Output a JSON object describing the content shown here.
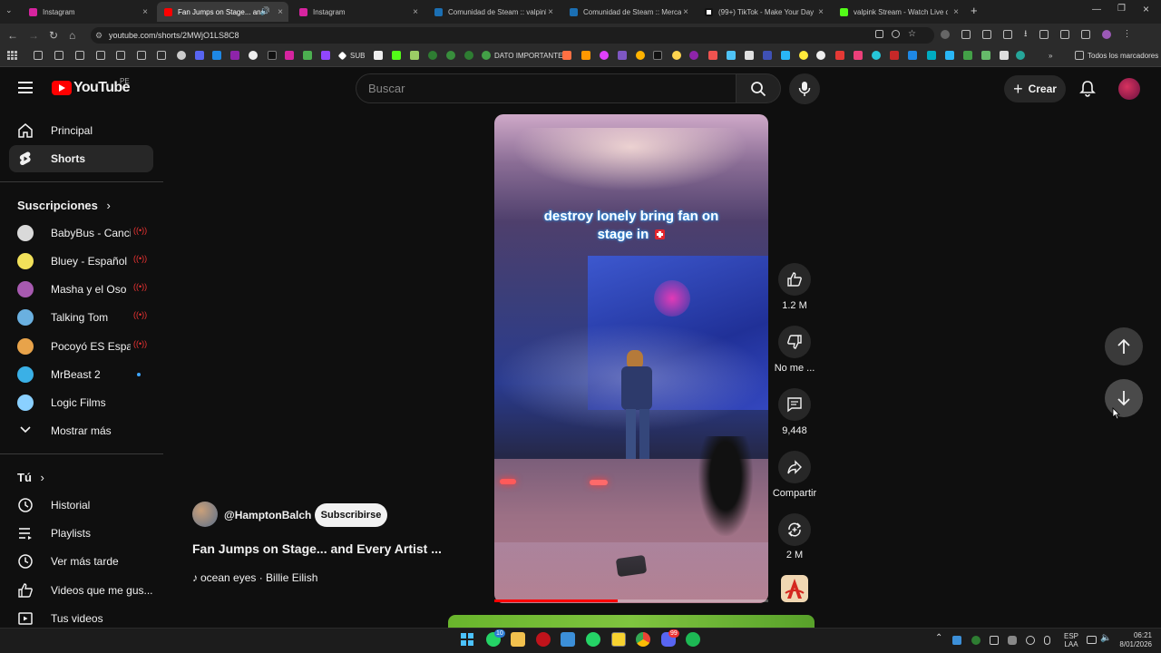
{
  "browser": {
    "tabs": [
      {
        "title": "Instagram",
        "color": "#d6249f"
      },
      {
        "title": "Fan Jumps on Stage... and Every Artist",
        "color": "#ff0000",
        "active": true
      },
      {
        "title": "Instagram",
        "color": "#d6249f"
      },
      {
        "title": "Comunidad de Steam :: valpink",
        "color": "#1b6fb3"
      },
      {
        "title": "Comunidad de Steam :: Mercado",
        "color": "#1b6fb3"
      },
      {
        "title": "(99+) TikTok - Make Your Day",
        "color": "#111111"
      },
      {
        "title": "valpink Stream - Watch Live on",
        "color": "#53fc18"
      }
    ],
    "url": "youtube.com/shorts/2MWjO1LS8C8",
    "bookmarks": {
      "sub_label": "SUB",
      "dato_label": "DATO IMPORTANTE",
      "all_label": "Todos los marcadores"
    }
  },
  "header": {
    "logo_text": "YouTube",
    "region": "PE",
    "search_placeholder": "Buscar",
    "create_label": "Crear"
  },
  "sidebar": {
    "main": [
      {
        "label": "Principal",
        "icon": "home-icon"
      },
      {
        "label": "Shorts",
        "icon": "shorts-icon",
        "active": true
      }
    ],
    "subscriptions_title": "Suscripciones",
    "subscriptions": [
      {
        "label": "BabyBus - Canci...",
        "avatar": "#d9d9d9",
        "live": true
      },
      {
        "label": "Bluey - Español ...",
        "avatar": "#f2e15a",
        "live": true
      },
      {
        "label": "Masha y el Oso",
        "avatar": "#a75ab0",
        "live": true
      },
      {
        "label": "Talking Tom",
        "avatar": "#6ab0e0",
        "live": true
      },
      {
        "label": "Pocoyó ΕS Españ...",
        "avatar": "#e8a34a",
        "live": true
      },
      {
        "label": "MrBeast 2",
        "avatar": "#3ab0e6",
        "dot": true
      },
      {
        "label": "Logic Films",
        "avatar": "#8ad0ff"
      }
    ],
    "show_more": "Mostrar más",
    "you_title": "Tú",
    "you": [
      {
        "label": "Historial",
        "icon": "history-icon"
      },
      {
        "label": "Playlists",
        "icon": "playlists-icon"
      },
      {
        "label": "Ver más tarde",
        "icon": "watch-later-icon"
      },
      {
        "label": "Videos que me gus...",
        "icon": "liked-icon"
      },
      {
        "label": "Tus videos",
        "icon": "your-videos-icon"
      }
    ]
  },
  "short": {
    "caption": "destroy lonely bring fan on stage in",
    "channel": "@HamptonBalch",
    "subscribe_label": "Subscribirse",
    "title": "Fan Jumps on Stage... and Every Artist ...",
    "music": "ocean eyes · Billie Eilish",
    "progress": 0.45,
    "actions": {
      "likes": "1.2 M",
      "dislike_label": "No me ...",
      "comments": "9,448",
      "share_label": "Compartir",
      "remix_count": "2 M"
    }
  },
  "taskbar": {
    "language": "ESP",
    "language_sub": "LAA",
    "time": "06:21",
    "date": "8/01/2026",
    "whatsapp_badge": "10",
    "discord_badge": "99"
  }
}
